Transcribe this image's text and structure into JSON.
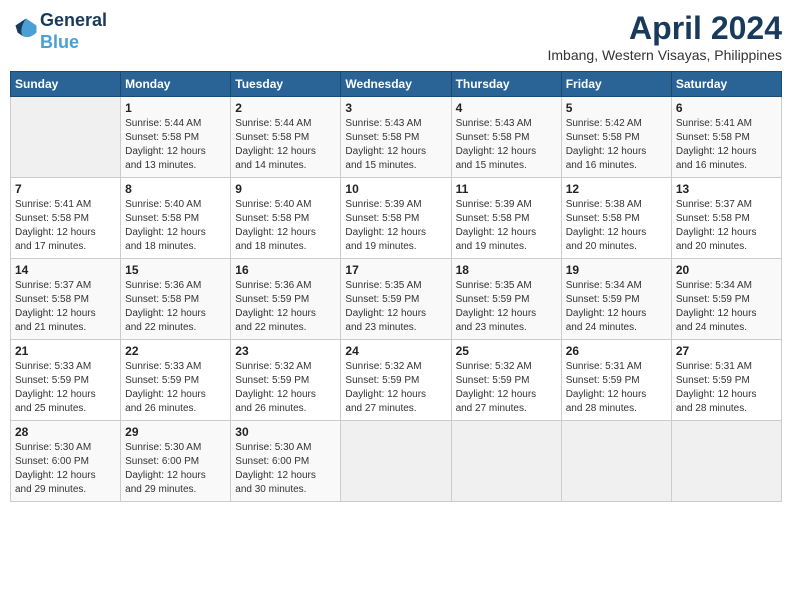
{
  "header": {
    "logo_line1": "General",
    "logo_line2": "Blue",
    "month": "April 2024",
    "location": "Imbang, Western Visayas, Philippines"
  },
  "weekdays": [
    "Sunday",
    "Monday",
    "Tuesday",
    "Wednesday",
    "Thursday",
    "Friday",
    "Saturday"
  ],
  "weeks": [
    [
      {
        "day": "",
        "info": ""
      },
      {
        "day": "1",
        "info": "Sunrise: 5:44 AM\nSunset: 5:58 PM\nDaylight: 12 hours\nand 13 minutes."
      },
      {
        "day": "2",
        "info": "Sunrise: 5:44 AM\nSunset: 5:58 PM\nDaylight: 12 hours\nand 14 minutes."
      },
      {
        "day": "3",
        "info": "Sunrise: 5:43 AM\nSunset: 5:58 PM\nDaylight: 12 hours\nand 15 minutes."
      },
      {
        "day": "4",
        "info": "Sunrise: 5:43 AM\nSunset: 5:58 PM\nDaylight: 12 hours\nand 15 minutes."
      },
      {
        "day": "5",
        "info": "Sunrise: 5:42 AM\nSunset: 5:58 PM\nDaylight: 12 hours\nand 16 minutes."
      },
      {
        "day": "6",
        "info": "Sunrise: 5:41 AM\nSunset: 5:58 PM\nDaylight: 12 hours\nand 16 minutes."
      }
    ],
    [
      {
        "day": "7",
        "info": "Sunrise: 5:41 AM\nSunset: 5:58 PM\nDaylight: 12 hours\nand 17 minutes."
      },
      {
        "day": "8",
        "info": "Sunrise: 5:40 AM\nSunset: 5:58 PM\nDaylight: 12 hours\nand 18 minutes."
      },
      {
        "day": "9",
        "info": "Sunrise: 5:40 AM\nSunset: 5:58 PM\nDaylight: 12 hours\nand 18 minutes."
      },
      {
        "day": "10",
        "info": "Sunrise: 5:39 AM\nSunset: 5:58 PM\nDaylight: 12 hours\nand 19 minutes."
      },
      {
        "day": "11",
        "info": "Sunrise: 5:39 AM\nSunset: 5:58 PM\nDaylight: 12 hours\nand 19 minutes."
      },
      {
        "day": "12",
        "info": "Sunrise: 5:38 AM\nSunset: 5:58 PM\nDaylight: 12 hours\nand 20 minutes."
      },
      {
        "day": "13",
        "info": "Sunrise: 5:37 AM\nSunset: 5:58 PM\nDaylight: 12 hours\nand 20 minutes."
      }
    ],
    [
      {
        "day": "14",
        "info": "Sunrise: 5:37 AM\nSunset: 5:58 PM\nDaylight: 12 hours\nand 21 minutes."
      },
      {
        "day": "15",
        "info": "Sunrise: 5:36 AM\nSunset: 5:58 PM\nDaylight: 12 hours\nand 22 minutes."
      },
      {
        "day": "16",
        "info": "Sunrise: 5:36 AM\nSunset: 5:59 PM\nDaylight: 12 hours\nand 22 minutes."
      },
      {
        "day": "17",
        "info": "Sunrise: 5:35 AM\nSunset: 5:59 PM\nDaylight: 12 hours\nand 23 minutes."
      },
      {
        "day": "18",
        "info": "Sunrise: 5:35 AM\nSunset: 5:59 PM\nDaylight: 12 hours\nand 23 minutes."
      },
      {
        "day": "19",
        "info": "Sunrise: 5:34 AM\nSunset: 5:59 PM\nDaylight: 12 hours\nand 24 minutes."
      },
      {
        "day": "20",
        "info": "Sunrise: 5:34 AM\nSunset: 5:59 PM\nDaylight: 12 hours\nand 24 minutes."
      }
    ],
    [
      {
        "day": "21",
        "info": "Sunrise: 5:33 AM\nSunset: 5:59 PM\nDaylight: 12 hours\nand 25 minutes."
      },
      {
        "day": "22",
        "info": "Sunrise: 5:33 AM\nSunset: 5:59 PM\nDaylight: 12 hours\nand 26 minutes."
      },
      {
        "day": "23",
        "info": "Sunrise: 5:32 AM\nSunset: 5:59 PM\nDaylight: 12 hours\nand 26 minutes."
      },
      {
        "day": "24",
        "info": "Sunrise: 5:32 AM\nSunset: 5:59 PM\nDaylight: 12 hours\nand 27 minutes."
      },
      {
        "day": "25",
        "info": "Sunrise: 5:32 AM\nSunset: 5:59 PM\nDaylight: 12 hours\nand 27 minutes."
      },
      {
        "day": "26",
        "info": "Sunrise: 5:31 AM\nSunset: 5:59 PM\nDaylight: 12 hours\nand 28 minutes."
      },
      {
        "day": "27",
        "info": "Sunrise: 5:31 AM\nSunset: 5:59 PM\nDaylight: 12 hours\nand 28 minutes."
      }
    ],
    [
      {
        "day": "28",
        "info": "Sunrise: 5:30 AM\nSunset: 6:00 PM\nDaylight: 12 hours\nand 29 minutes."
      },
      {
        "day": "29",
        "info": "Sunrise: 5:30 AM\nSunset: 6:00 PM\nDaylight: 12 hours\nand 29 minutes."
      },
      {
        "day": "30",
        "info": "Sunrise: 5:30 AM\nSunset: 6:00 PM\nDaylight: 12 hours\nand 30 minutes."
      },
      {
        "day": "",
        "info": ""
      },
      {
        "day": "",
        "info": ""
      },
      {
        "day": "",
        "info": ""
      },
      {
        "day": "",
        "info": ""
      }
    ]
  ]
}
